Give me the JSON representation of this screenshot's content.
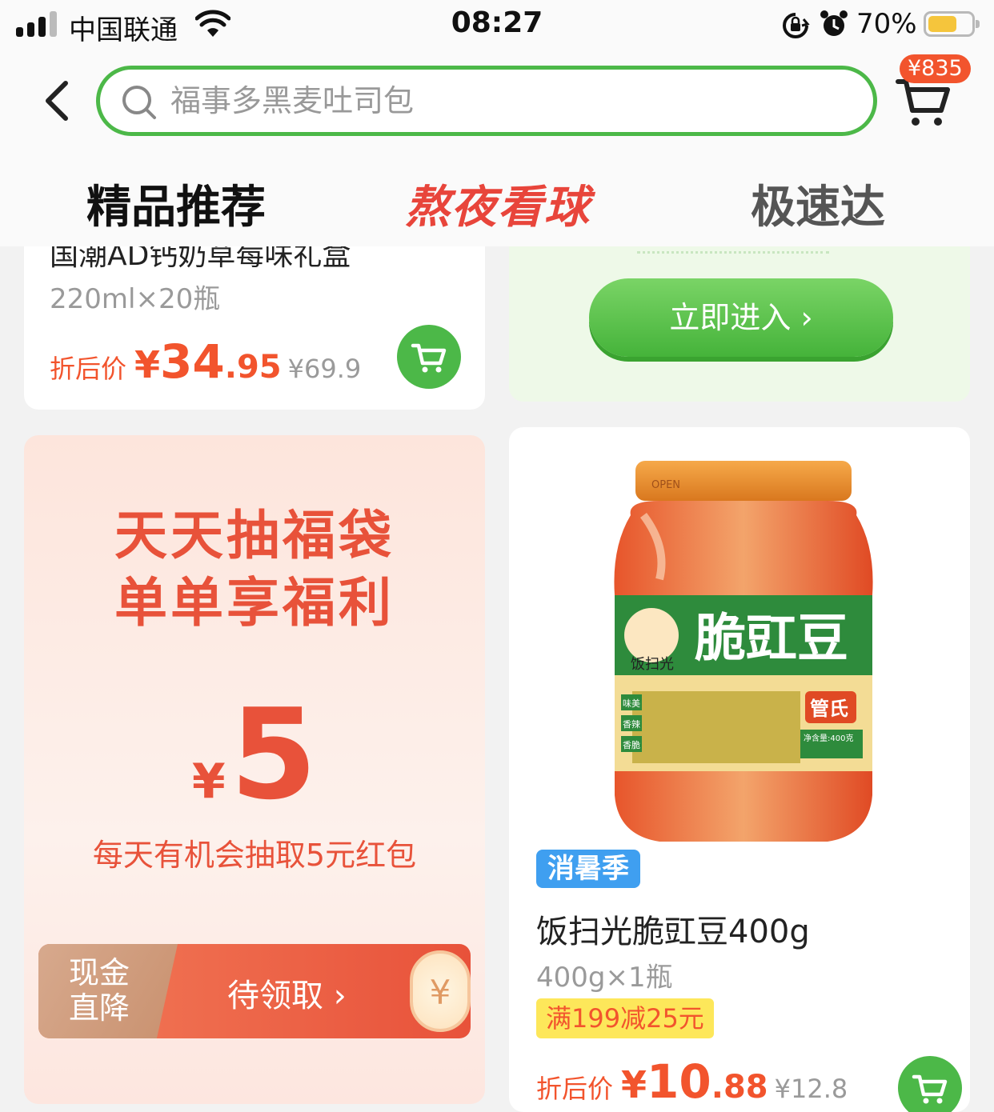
{
  "status_bar": {
    "carrier": "中国联通",
    "time": "08:27",
    "battery_percent": "70%",
    "battery_level": 0.7,
    "icons": [
      "signal-icon",
      "wifi-icon",
      "orientation-lock-icon",
      "alarm-icon",
      "battery-icon"
    ]
  },
  "header": {
    "search_placeholder": "福事多黑麦吐司包",
    "cart_badge": "¥835",
    "icons": [
      "back-icon",
      "search-icon",
      "cart-icon"
    ]
  },
  "tabs": [
    {
      "label": "精品推荐",
      "active": true
    },
    {
      "label": "熬夜看球",
      "active": false
    },
    {
      "label": "极速达",
      "active": false
    }
  ],
  "product_top_left": {
    "title": "国潮AD钙奶草莓味礼盒",
    "spec": "220ml×20瓶",
    "price_label": "折后价",
    "price_yen": "¥",
    "price_int": "34",
    "price_dec": ".95",
    "price_original": "¥69.9"
  },
  "entry_card": {
    "button_label": "立即进入 ›"
  },
  "promo_card": {
    "title_line1": "天天抽福袋",
    "title_line2": "单单享福利",
    "amount_yen": "¥",
    "amount": "5",
    "description": "每天有机会抽取5元红包",
    "coupon_type": "现金直降",
    "coupon_cta": "待领取 ›",
    "coupon_coin": "¥"
  },
  "product_bottom_right": {
    "badge": "消暑季",
    "title": "饭扫光脆豇豆400g",
    "spec": "400g×1瓶",
    "promotion": "满199减25元",
    "price_label": "折后价",
    "price_yen": "¥",
    "price_int": "10",
    "price_dec": ".88",
    "price_original": "¥12.8",
    "jar_label_text": "脆豇豆",
    "jar_brand": "管氏",
    "jar_logo": "饭扫光",
    "jar_lid_text": "OPEN",
    "jar_net": "净含量:400克",
    "jar_tags": [
      "味美",
      "香辣",
      "香脆"
    ]
  },
  "colors": {
    "accent_green": "#4cb848",
    "price_orange": "#f2542d",
    "promo_red": "#e8523a",
    "tag_blue": "#3f9ff0",
    "tag_yellow": "#fde75a"
  }
}
